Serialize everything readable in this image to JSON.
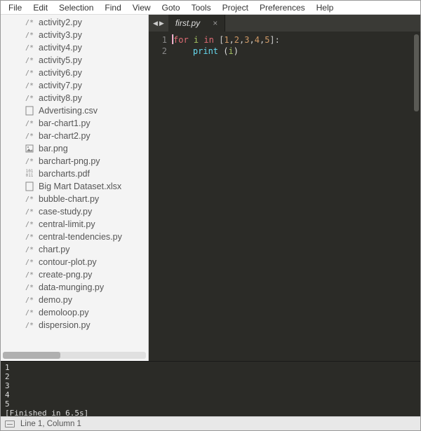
{
  "menu": [
    "File",
    "Edit",
    "Selection",
    "Find",
    "View",
    "Goto",
    "Tools",
    "Project",
    "Preferences",
    "Help"
  ],
  "sidebar": {
    "files": [
      {
        "icon": "code",
        "name": "activity2.py"
      },
      {
        "icon": "code",
        "name": "activity3.py"
      },
      {
        "icon": "code",
        "name": "activity4.py"
      },
      {
        "icon": "code",
        "name": "activity5.py"
      },
      {
        "icon": "code",
        "name": "activity6.py"
      },
      {
        "icon": "code",
        "name": "activity7.py"
      },
      {
        "icon": "code",
        "name": "activity8.py"
      },
      {
        "icon": "doc",
        "name": "Advertising.csv"
      },
      {
        "icon": "code",
        "name": "bar-chart1.py"
      },
      {
        "icon": "code",
        "name": "bar-chart2.py"
      },
      {
        "icon": "img",
        "name": "bar.png"
      },
      {
        "icon": "code",
        "name": "barchart-png.py"
      },
      {
        "icon": "bin",
        "name": "barcharts.pdf"
      },
      {
        "icon": "doc",
        "name": "Big Mart Dataset.xlsx"
      },
      {
        "icon": "code",
        "name": "bubble-chart.py"
      },
      {
        "icon": "code",
        "name": "case-study.py"
      },
      {
        "icon": "code",
        "name": "central-limit.py"
      },
      {
        "icon": "code",
        "name": "central-tendencies.py"
      },
      {
        "icon": "code",
        "name": "chart.py"
      },
      {
        "icon": "code",
        "name": "contour-plot.py"
      },
      {
        "icon": "code",
        "name": "create-png.py"
      },
      {
        "icon": "code",
        "name": "data-munging.py"
      },
      {
        "icon": "code",
        "name": "demo.py"
      },
      {
        "icon": "code",
        "name": "demoloop.py"
      },
      {
        "icon": "code",
        "name": "dispersion.py"
      }
    ]
  },
  "tab": {
    "name": "first.py",
    "close": "×"
  },
  "nav": {
    "prev": "◀",
    "next": "▶"
  },
  "code": {
    "lines": [
      "1",
      "2"
    ],
    "l1": {
      "kw1": "for",
      "var": "i",
      "kw2": "in",
      "nums": [
        "1",
        "2",
        "3",
        "4",
        "5"
      ]
    },
    "l2": {
      "func": "print",
      "var": "i"
    }
  },
  "console": "1\n2\n3\n4\n5\n[Finished in 6.5s]",
  "status": {
    "pos": "Line 1, Column 1"
  },
  "icons": {
    "code": "/*",
    "doc": "▯",
    "img": "▣",
    "bin": "101\n011"
  }
}
